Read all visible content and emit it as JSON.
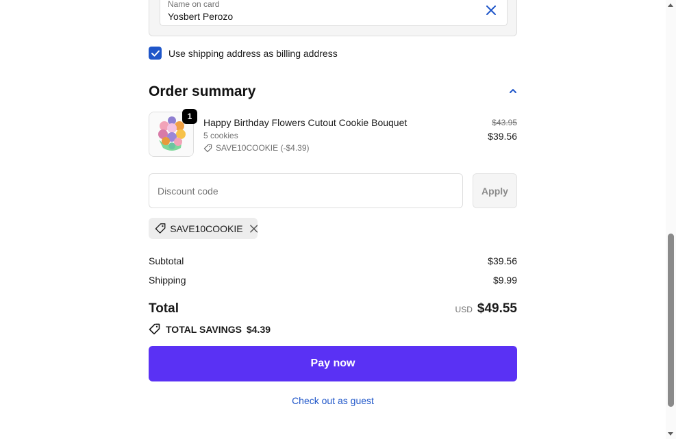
{
  "payment": {
    "name_label": "Name on card",
    "name_value": "Yosbert Perozo",
    "billing_label": "Use shipping address as billing address",
    "billing_checked": true
  },
  "summary": {
    "title": "Order summary",
    "item": {
      "quantity": "1",
      "name": "Happy Birthday Flowers Cutout Cookie Bouquet",
      "variant": "5 cookies",
      "discount": "SAVE10COOKIE (-$4.39)",
      "original_price": "$43.95",
      "price": "$39.56"
    },
    "discount_placeholder": "Discount code",
    "apply_label": "Apply",
    "applied_code": "SAVE10COOKIE",
    "subtotal_label": "Subtotal",
    "subtotal_value": "$39.56",
    "shipping_label": "Shipping",
    "shipping_value": "$9.99",
    "total_label": "Total",
    "total_currency": "USD",
    "total_value": "$49.55",
    "savings_label": "TOTAL SAVINGS",
    "savings_value": "$4.39"
  },
  "actions": {
    "pay_label": "Pay now",
    "guest_label": "Check out as guest"
  },
  "colors": {
    "accent": "#5a31f4",
    "link": "#1f56c9"
  }
}
